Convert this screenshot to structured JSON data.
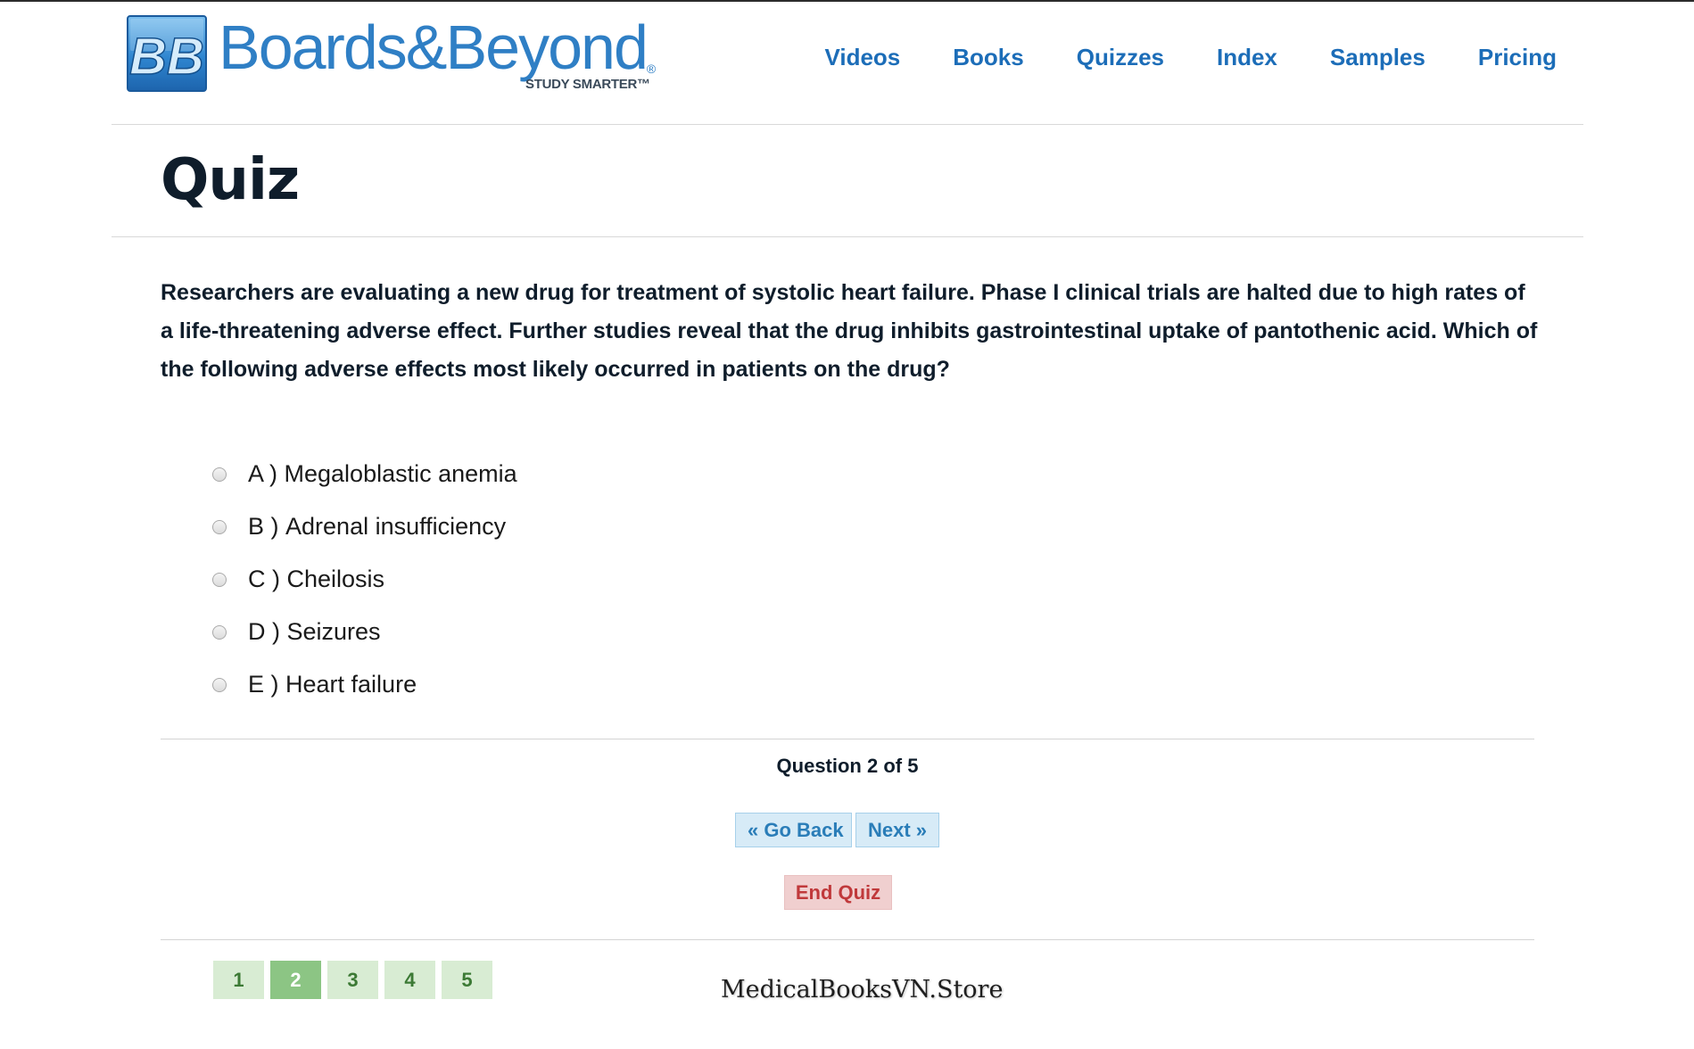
{
  "header": {
    "logo": {
      "monogram": "BB",
      "brand": "Boards&Beyond",
      "registered": "®",
      "tagline": "STUDY SMARTER™"
    },
    "nav": [
      {
        "label": "Videos"
      },
      {
        "label": "Books"
      },
      {
        "label": "Quizzes"
      },
      {
        "label": "Index"
      },
      {
        "label": "Samples"
      },
      {
        "label": "Pricing"
      }
    ]
  },
  "page": {
    "title": "Quiz"
  },
  "question": {
    "text": "Researchers are evaluating a new drug for treatment of systolic heart failure. Phase I clinical trials are halted due to high rates of a life-threatening adverse effect. Further studies reveal that the drug inhibits gastrointestinal uptake of pantothenic acid. Which of the following adverse effects most likely occurred in patients on the drug?",
    "choices": [
      {
        "letter": "A ) ",
        "text": "Megaloblastic anemia",
        "selected": false
      },
      {
        "letter": "B ) ",
        "text": "Adrenal insufficiency",
        "selected": false
      },
      {
        "letter": "C ) ",
        "text": "Cheilosis",
        "selected": false
      },
      {
        "letter": "D ) ",
        "text": "Seizures",
        "selected": false
      },
      {
        "letter": "E ) ",
        "text": "Heart failure",
        "selected": false
      }
    ]
  },
  "quiz_nav": {
    "progress": "Question 2 of 5",
    "current": 2,
    "total": 5,
    "back_label": "« Go Back",
    "next_label": "Next »",
    "end_label": "End Quiz",
    "pages": [
      "1",
      "2",
      "3",
      "4",
      "5"
    ]
  },
  "watermark": "MedicalBooksVN.Store",
  "colors": {
    "brand_blue": "#2f7fc5",
    "nav_link": "#1c6db8",
    "heading": "#0f1d2b",
    "button_bg": "#d7ebf7",
    "button_text": "#2a7db8",
    "end_bg": "#f0cfcf",
    "end_text": "#c0393b",
    "page_bg": "#d8ecd3",
    "page_active_bg": "#8cc584",
    "page_text": "#3c7a35"
  }
}
